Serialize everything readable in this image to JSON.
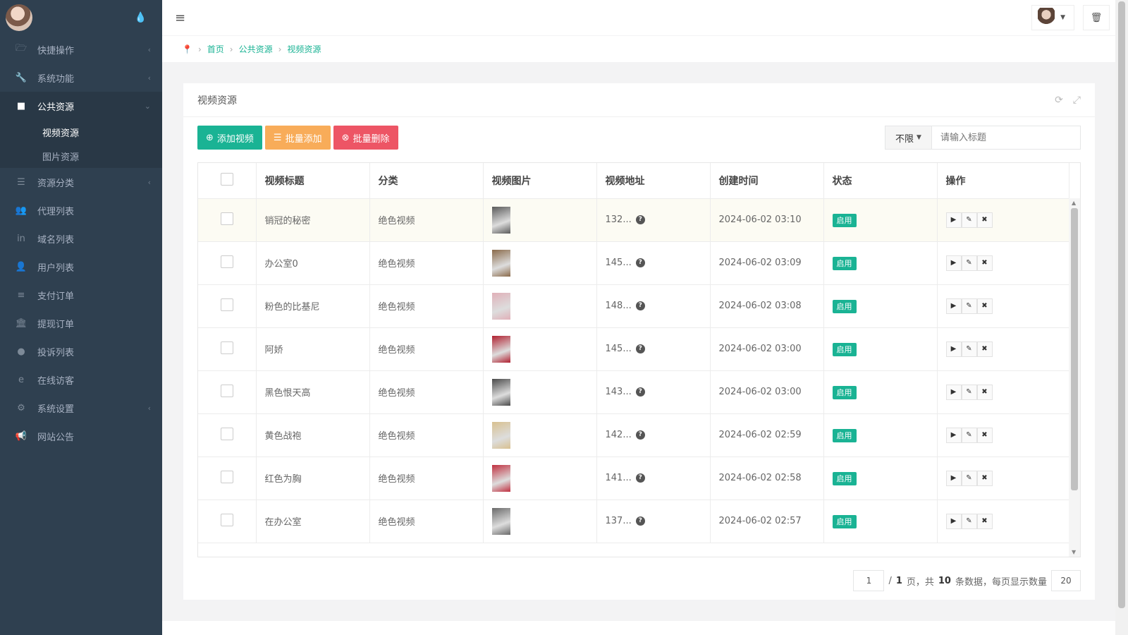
{
  "sidebar": {
    "items": [
      {
        "label": "快捷操作",
        "icon": "folder-icon",
        "glyph": "🗁",
        "arrow": "‹"
      },
      {
        "label": "系统功能",
        "icon": "wrench-icon",
        "glyph": "🔧",
        "arrow": "‹"
      },
      {
        "label": "公共资源",
        "icon": "video-camera-icon",
        "glyph": "■",
        "arrow": "⌄"
      },
      {
        "label": "资源分类",
        "icon": "list-icon",
        "glyph": "☰",
        "arrow": "‹"
      },
      {
        "label": "代理列表",
        "icon": "users-icon",
        "glyph": "👥",
        "arrow": ""
      },
      {
        "label": "域名列表",
        "icon": "linkedin-icon",
        "glyph": "in",
        "arrow": ""
      },
      {
        "label": "用户列表",
        "icon": "user-icon",
        "glyph": "👤",
        "arrow": ""
      },
      {
        "label": "支付订单",
        "icon": "database-icon",
        "glyph": "≡",
        "arrow": ""
      },
      {
        "label": "提现订单",
        "icon": "bank-icon",
        "glyph": "🏛",
        "arrow": ""
      },
      {
        "label": "投诉列表",
        "icon": "info-icon",
        "glyph": "●",
        "arrow": ""
      },
      {
        "label": "在线访客",
        "icon": "internet-explorer-icon",
        "glyph": "e",
        "arrow": ""
      },
      {
        "label": "系统设置",
        "icon": "gear-icon",
        "glyph": "⚙",
        "arrow": "‹"
      },
      {
        "label": "网站公告",
        "icon": "bullhorn-icon",
        "glyph": "📢",
        "arrow": ""
      }
    ],
    "sub_items": [
      "视频资源",
      "图片资源"
    ]
  },
  "breadcrumb": [
    "首页",
    "公共资源",
    "视频资源"
  ],
  "panel": {
    "title": "视频资源",
    "buttons": {
      "add": "添加视频",
      "batch_add": "批量添加",
      "batch_delete": "批量删除"
    },
    "filter": {
      "selected": "不限",
      "placeholder": "请输入标题"
    }
  },
  "table": {
    "headers": [
      "视频标题",
      "分类",
      "视频图片",
      "视频地址",
      "创建时间",
      "状态",
      "操作"
    ],
    "rows": [
      {
        "title": "销冠的秘密",
        "category": "绝色视频",
        "url": "132...",
        "created": "2024-06-02 03:10",
        "status": "启用",
        "thumb": "#5a5a5a"
      },
      {
        "title": "办公室0",
        "category": "绝色视频",
        "url": "145...",
        "created": "2024-06-02 03:09",
        "status": "启用",
        "thumb": "#8a6a4a"
      },
      {
        "title": "粉色的比基尼",
        "category": "绝色视频",
        "url": "148...",
        "created": "2024-06-02 03:08",
        "status": "启用",
        "thumb": "#e0b0b8"
      },
      {
        "title": "阿娇",
        "category": "绝色视频",
        "url": "145...",
        "created": "2024-06-02 03:00",
        "status": "启用",
        "thumb": "#b02030"
      },
      {
        "title": "黑色恨天高",
        "category": "绝色视频",
        "url": "143...",
        "created": "2024-06-02 03:00",
        "status": "启用",
        "thumb": "#4a4a4a"
      },
      {
        "title": "黄色战袍",
        "category": "绝色视频",
        "url": "142...",
        "created": "2024-06-02 02:59",
        "status": "启用",
        "thumb": "#d8c090"
      },
      {
        "title": "红色为胸",
        "category": "绝色视频",
        "url": "141...",
        "created": "2024-06-02 02:58",
        "status": "启用",
        "thumb": "#c03040"
      },
      {
        "title": "在办公室",
        "category": "绝色视频",
        "url": "137...",
        "created": "2024-06-02 02:57",
        "status": "启用",
        "thumb": "#6a6a6a"
      }
    ]
  },
  "pager": {
    "page": "1",
    "slash": "/",
    "total_pages": "1",
    "page_unit": "页，共",
    "total_rows": "10",
    "rows_unit": "条数据，每页显示数量",
    "per_page": "20"
  },
  "colors": {
    "sidebar": "#2f4050",
    "accent": "#1ab394",
    "orange": "#f8ac59",
    "red": "#ed5565"
  }
}
